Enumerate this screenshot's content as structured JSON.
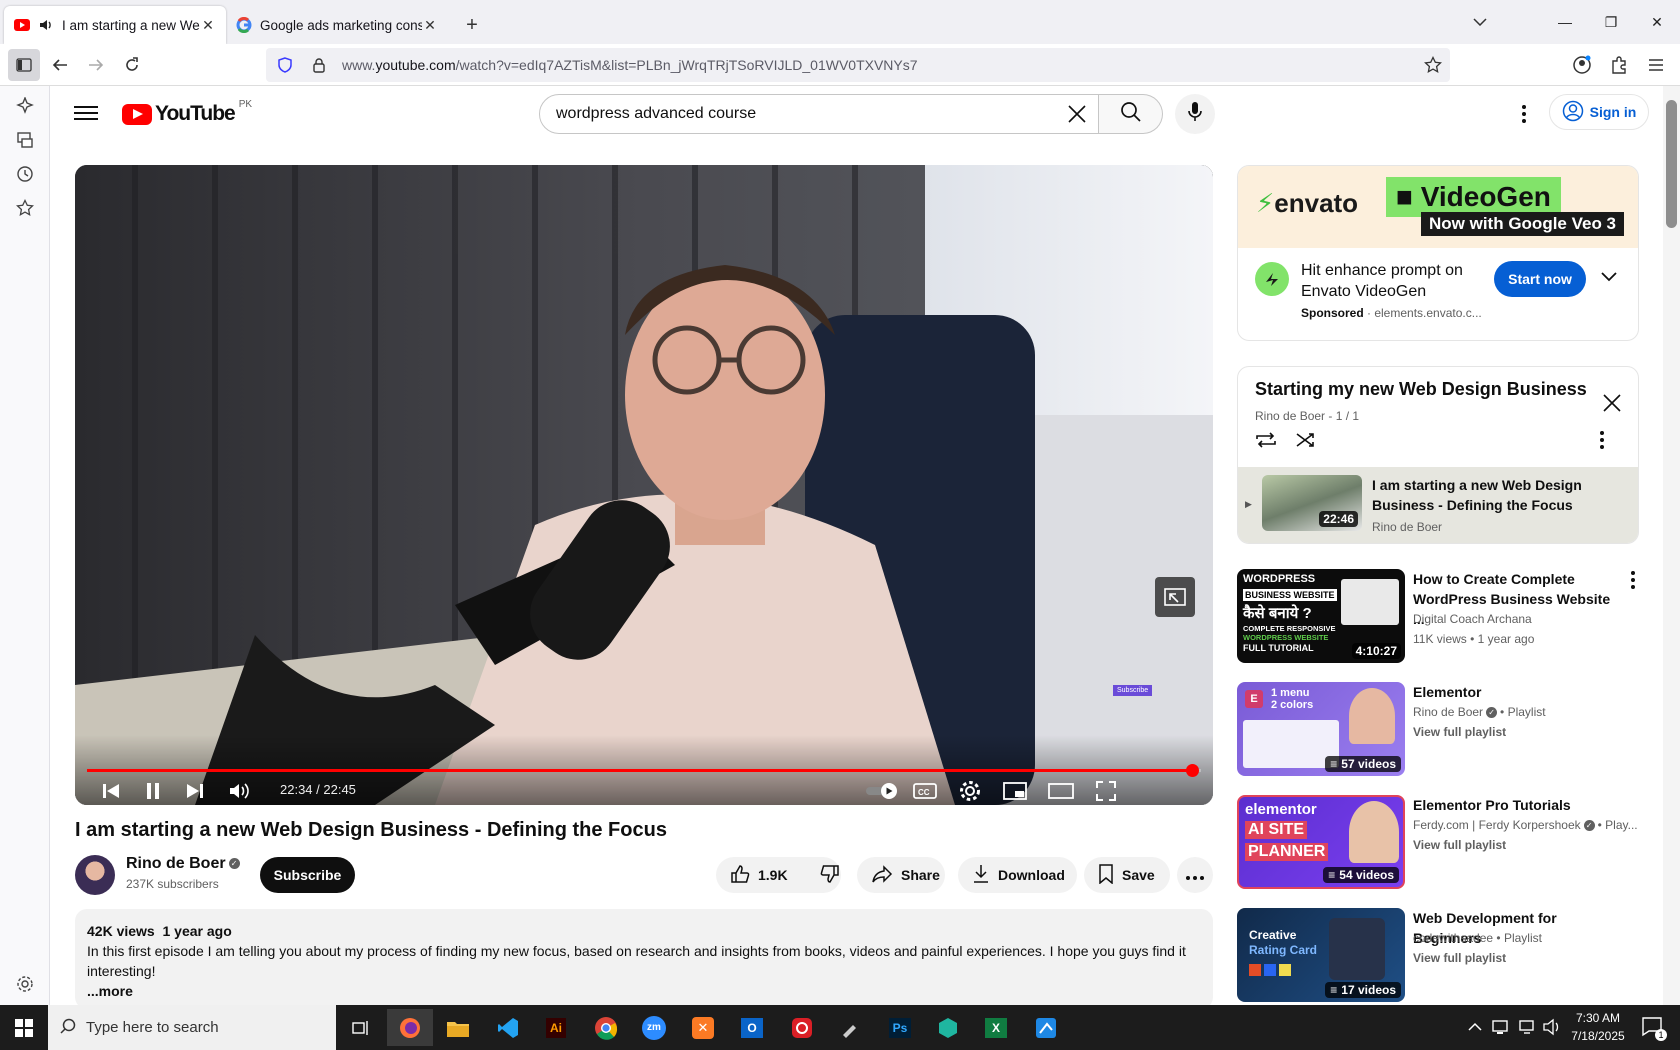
{
  "browser": {
    "tabs": [
      {
        "title": "I am starting a new Web Design Business - Defining the Focus",
        "active": true
      },
      {
        "title": "Google ads marketing consultant",
        "active": false
      }
    ],
    "url_prefix": "www.",
    "url_domain": "youtube.com",
    "url_path": "/watch?v=edIq7AZTisM&list=PLBn_jWrqTRjTSoRVIJLD_01WV0TXVNYs7"
  },
  "youtube": {
    "logo_text": "YouTube",
    "country_code": "PK",
    "search_value": "wordpress advanced course",
    "signin_label": "Sign in"
  },
  "player": {
    "time_current": "22:34",
    "time_total": "22:45",
    "time_display": "22:34 / 22:45",
    "progress_fraction": 0.992,
    "subscribe_watermark": "Subscribe"
  },
  "video": {
    "title": "I am starting a new Web Design Business - Defining the Focus",
    "channel": "Rino de Boer",
    "subscribers": "237K subscribers",
    "subscribe_label": "Subscribe",
    "likes": "1.9K",
    "share_label": "Share",
    "download_label": "Download",
    "save_label": "Save",
    "views": "42K views",
    "age": "1 year ago",
    "description": "In this first episode I am telling you about my process of finding my new focus, based on research and insights from books, videos and painful experiences. I hope you guys find it interesting!",
    "more_label": "...more"
  },
  "ad": {
    "brand": "envato",
    "product": "VideoGen",
    "tagline": "Now with Google Veo 3",
    "text": "Hit enhance prompt on Envato VideoGen",
    "sponsored": "Sponsored",
    "domain": "elements.envato.c...",
    "cta": "Start now"
  },
  "playlist": {
    "title": "Starting my new Web Design Business",
    "subtitle": "Rino de Boer - 1 / 1",
    "item": {
      "title": "I am starting a new Web Design Business - Defining the Focus",
      "channel": "Rino de Boer",
      "duration": "22:46"
    }
  },
  "recommendations": [
    {
      "title": "How to Create Complete WordPress Business Website ...",
      "channel": "Digital Coach Archana",
      "meta": "11K views • 1 year ago",
      "badge": "4:10:27",
      "kind": "video",
      "thumb_text": [
        "WORDPRESS",
        "BUSINESS WEBSITE",
        "कैसे बनाये ?",
        "COMPLETE RESPONSIVE",
        "WORDPRESS WEBSITE",
        "FULL TUTORIAL"
      ]
    },
    {
      "title": "Elementor",
      "channel": "Rino de Boer",
      "channel_suffix": "• Playlist",
      "meta": "View full playlist",
      "badge": "57 videos",
      "kind": "playlist",
      "thumb_text": [
        "1 menu",
        "2 colors"
      ]
    },
    {
      "title": "Elementor Pro Tutorials",
      "channel": "Ferdy.com | Ferdy Korpershoek",
      "channel_suffix": "• Play...",
      "meta": "View full playlist",
      "badge": "54 videos",
      "kind": "playlist",
      "thumb_text": [
        "elementor",
        "AI SITE",
        "PLANNER"
      ]
    },
    {
      "title": "Web Development for Beginners",
      "channel": "codewithsadee",
      "channel_suffix": "• Playlist",
      "meta": "View full playlist",
      "badge": "17 videos",
      "kind": "playlist",
      "thumb_text": [
        "Creative",
        "Rating Card"
      ]
    }
  ],
  "taskbar": {
    "search_placeholder": "Type here to search",
    "time": "7:30 AM",
    "date": "7/18/2025",
    "notifications": "1"
  }
}
